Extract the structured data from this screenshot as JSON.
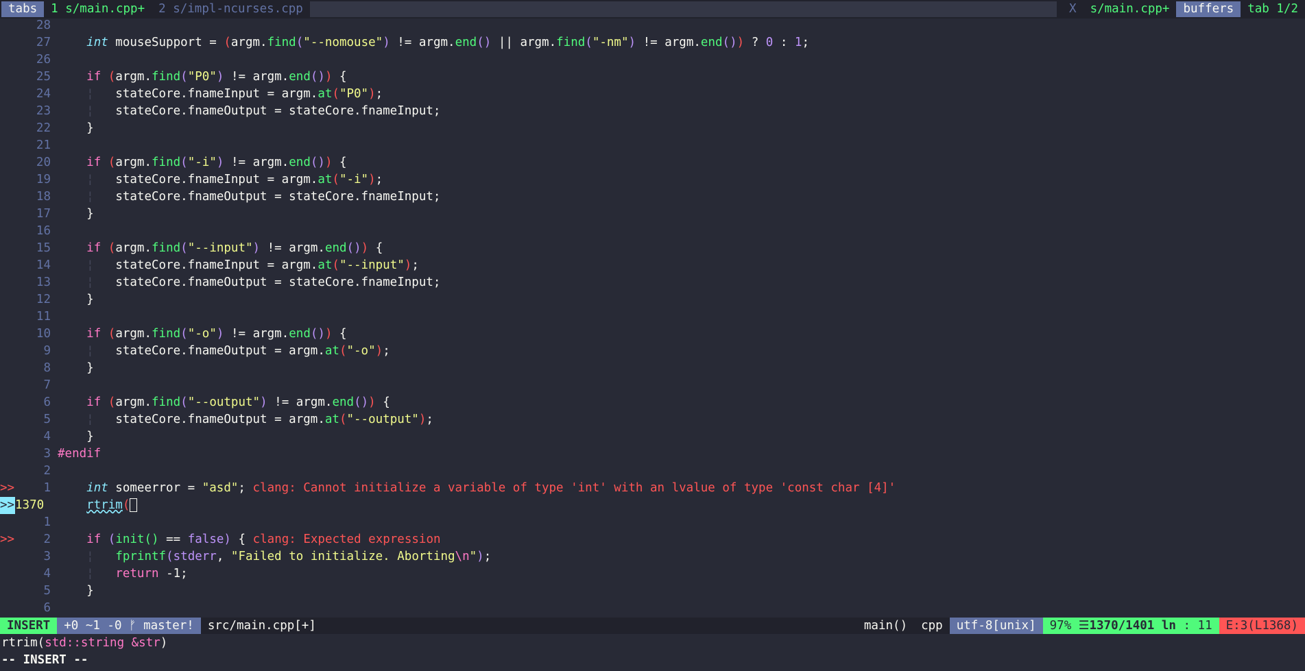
{
  "tabline": {
    "tabs_label": "tabs",
    "tabs": [
      {
        "label": "1 s/main.cpp+",
        "active": true
      },
      {
        "label": "2 s/impl-ncurses.cpp",
        "active": false
      }
    ],
    "close_label": "X",
    "current_buffer": "s/main.cpp+",
    "buffers_label": "buffers",
    "tab_count": "tab 1/2"
  },
  "editor": {
    "lines": [
      {
        "n": "28",
        "code": ""
      },
      {
        "n": "27",
        "code": "mouse"
      },
      {
        "n": "26",
        "code": ""
      },
      {
        "n": "25",
        "code": "if_p0"
      },
      {
        "n": "24",
        "code": "in_p0"
      },
      {
        "n": "23",
        "code": "out_in"
      },
      {
        "n": "22",
        "code": "close"
      },
      {
        "n": "21",
        "code": ""
      },
      {
        "n": "20",
        "code": "if_i"
      },
      {
        "n": "19",
        "code": "in_i"
      },
      {
        "n": "18",
        "code": "out_in"
      },
      {
        "n": "17",
        "code": "close"
      },
      {
        "n": "16",
        "code": ""
      },
      {
        "n": "15",
        "code": "if_input"
      },
      {
        "n": "14",
        "code": "in_input"
      },
      {
        "n": "13",
        "code": "out_in"
      },
      {
        "n": "12",
        "code": "close"
      },
      {
        "n": "11",
        "code": ""
      },
      {
        "n": "10",
        "code": "if_o"
      },
      {
        "n": "9",
        "code": "out_o"
      },
      {
        "n": "8",
        "code": "close"
      },
      {
        "n": "7",
        "code": ""
      },
      {
        "n": "6",
        "code": "if_output"
      },
      {
        "n": "5",
        "code": "out_output"
      },
      {
        "n": "4",
        "code": "close"
      },
      {
        "n": "3",
        "code": "endif"
      },
      {
        "n": "2",
        "code": ""
      },
      {
        "n": "1",
        "code": "someerror",
        "sign": ">>"
      },
      {
        "n": "1370",
        "code": "rtrim",
        "sign": ">>",
        "current": true
      },
      {
        "n": "1",
        "code": ""
      },
      {
        "n": "2",
        "code": "if_init",
        "sign": ">>"
      },
      {
        "n": "3",
        "code": "fprintf"
      },
      {
        "n": "4",
        "code": "ret"
      },
      {
        "n": "5",
        "code": "close"
      },
      {
        "n": "6",
        "code": ""
      }
    ],
    "text": {
      "int": "int",
      "if": "if",
      "mouseSupport": " mouseSupport = ",
      "argm_find": "argm.",
      "find": "find",
      "end": "end",
      "at": "at",
      "nomouse": "\"--nomouse\"",
      "nm": "\"-nm\"",
      "ne": " != ",
      "or": " || ",
      "ternary_q": " ? ",
      "zero": "0",
      "ternary_c": " : ",
      "one": "1",
      "semi": ";",
      "open_brace": " {",
      "close_brace": "}",
      "p0": "\"P0\"",
      "i": "\"-i\"",
      "input": "\"--input\"",
      "o": "\"-o\"",
      "output": "\"--output\"",
      "fnameInput_assign": "stateCore.fnameInput = argm.",
      "fnameOutput_assign_argm": "stateCore.fnameOutput = argm.",
      "fnameOutput_assign_input": "stateCore.fnameOutput = stateCore.fnameInput;",
      "endif": "#endif",
      "someerror": " someerror = ",
      "asd": "\"asd\"",
      "someerror_diag": "clang: Cannot initialize a variable of type 'int' with an lvalue of type 'const char [4]'",
      "rtrim": "rtrim",
      "init": "init",
      "false": "false",
      "eqeq": " == ",
      "init_diag": "clang: Expected expression",
      "fprintf": "fprintf",
      "stderr": "stderr",
      "failed": "\"Failed to initialize. Aborting",
      "newline_esc": "\\n",
      "quote": "\"",
      "return": "return",
      "minus_one": " -1;"
    }
  },
  "statusline": {
    "mode": "INSERT",
    "git": "+0 ~1 -0 ᚠ master!",
    "filename": "src/main.cpp[+]",
    "function": "main()",
    "filetype": "cpp",
    "encoding": "utf-8[unix]",
    "percent": "97%",
    "line_icon": "☰",
    "line_pos": "1370/1401",
    "col_label": "ln",
    "col": ": 11",
    "diagnostics": "E:3(L1368)"
  },
  "cmdline": {
    "signature_fn": "rtrim(",
    "signature_arg": "std::string &str",
    "signature_close": ")",
    "mode_message": "-- INSERT --"
  }
}
